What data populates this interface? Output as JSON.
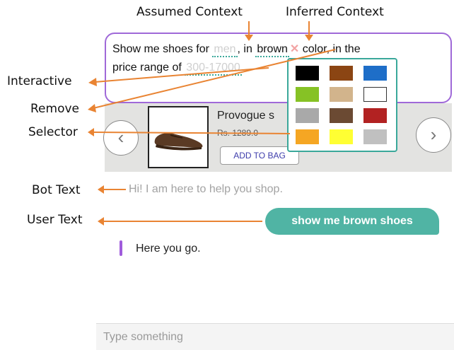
{
  "callouts": {
    "assumed_context": "Assumed Context",
    "inferred_context": "Inferred Context",
    "interactive": "Interactive",
    "remove": "Remove",
    "selector": "Selector",
    "bot_text": "Bot Text",
    "user_text": "User Text"
  },
  "query": {
    "prefix": "Show me shoes for",
    "gender": "men",
    "mid": ", in",
    "color": "brown",
    "remove_glyph": "✕",
    "suffix": "color, in the",
    "line2_prefix": "price range of",
    "price_range": "300-17000"
  },
  "product": {
    "name": "Provogue s",
    "price": "Rs. 1289.0",
    "add_to_bag": "ADD TO BAG",
    "prev_glyph": "‹",
    "next_glyph": "›"
  },
  "palette_colors": [
    "#000000",
    "#8B4513",
    "#1E6EC8",
    "#86C225",
    "#D2B48C",
    "#FFFFFF",
    "#A9A9A9",
    "#6B4A33",
    "#B22222",
    "#F5A623",
    "#FFFF33",
    "#C0C0C0"
  ],
  "arrow_color": "#e98433",
  "chat": {
    "bot_text": "Hi! I am here to help you shop.",
    "user_text": "show me brown shoes",
    "bot_reply": "Here you go."
  },
  "composer": {
    "placeholder": "Type something"
  }
}
